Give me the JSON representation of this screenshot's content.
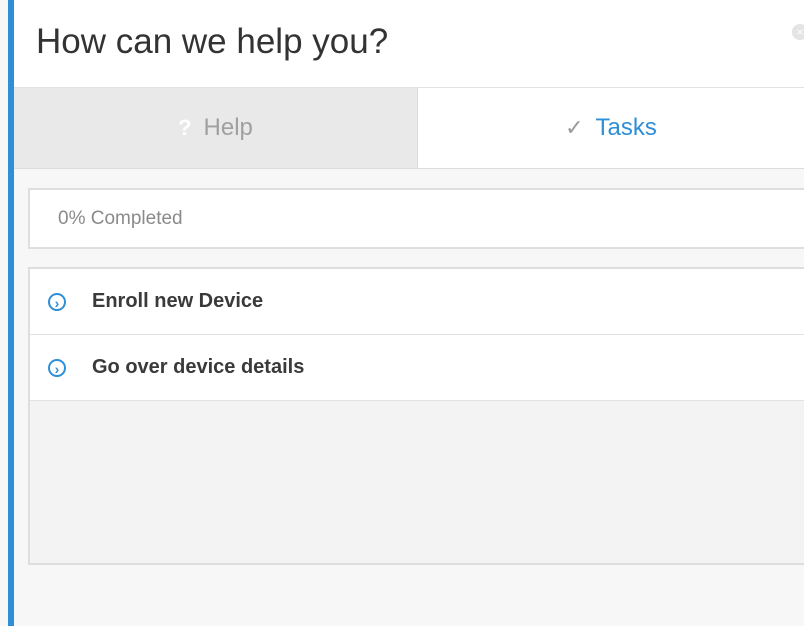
{
  "header": {
    "title": "How can we help you?",
    "close_icon": "×"
  },
  "tabs": [
    {
      "label": "Help",
      "icon": "?",
      "icon_name": "question-icon",
      "active": false
    },
    {
      "label": "Tasks",
      "icon": "✓",
      "icon_name": "checkmark-icon",
      "active": true
    }
  ],
  "progress": {
    "text": "0% Completed"
  },
  "tasks": [
    {
      "label": "Enroll new Device",
      "icon": "›",
      "icon_name": "chevron-right-circle-icon"
    },
    {
      "label": "Go over device details",
      "icon": "›",
      "icon_name": "chevron-right-circle-icon"
    }
  ],
  "colors": {
    "accent": "#2f8fd6",
    "inactive_tab": "#e9e9e9",
    "text": "#333333"
  }
}
